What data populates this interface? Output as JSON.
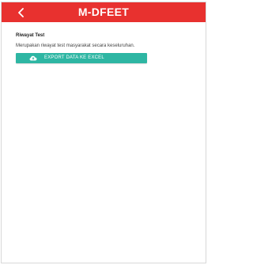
{
  "header": {
    "title": "M-DFEET",
    "back_icon": "chevron-left-icon",
    "color": "#e8312f"
  },
  "section": {
    "title": "Riwayat Test",
    "description": "Merupakan riwayat test masyarakat secara keseluruhan."
  },
  "export_button": {
    "label": "EXPORT DATA KE EXCEL",
    "icon": "cloud-upload-icon",
    "color": "#2eb6a3"
  }
}
